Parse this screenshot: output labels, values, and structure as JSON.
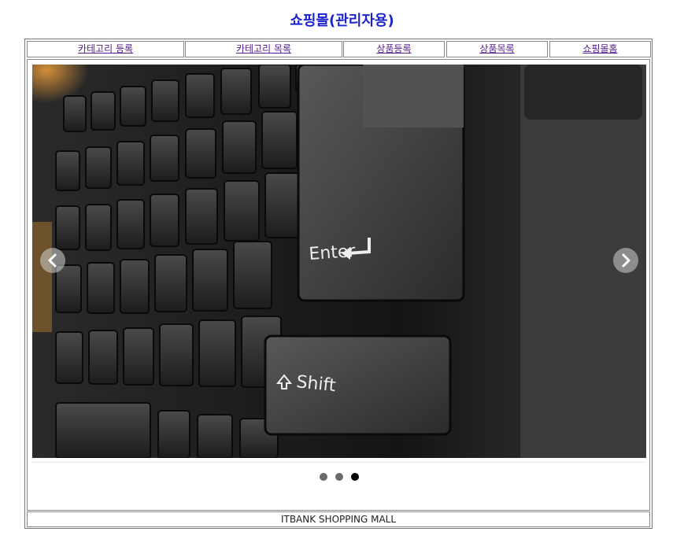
{
  "page": {
    "title": "쇼핑몰(관리자용)"
  },
  "menu": {
    "items": [
      {
        "label": "카테고리 등록"
      },
      {
        "label": "카테고리 목록"
      },
      {
        "label": "상품등록"
      },
      {
        "label": "상품목록"
      },
      {
        "label": "쇼핑몰홈"
      }
    ]
  },
  "slider": {
    "image_keys": {
      "enter": "Enter",
      "shift": "Shift"
    },
    "prev_icon": "chevron-left-icon",
    "next_icon": "chevron-right-icon",
    "slide_count": 3,
    "active_slide": 3
  },
  "footer": {
    "text": "ITBANK SHOPPING MALL"
  },
  "colors": {
    "title": "#1d24c9",
    "link": "#551a8b",
    "dot": "#6a6a6a",
    "dot_active": "#000000"
  }
}
